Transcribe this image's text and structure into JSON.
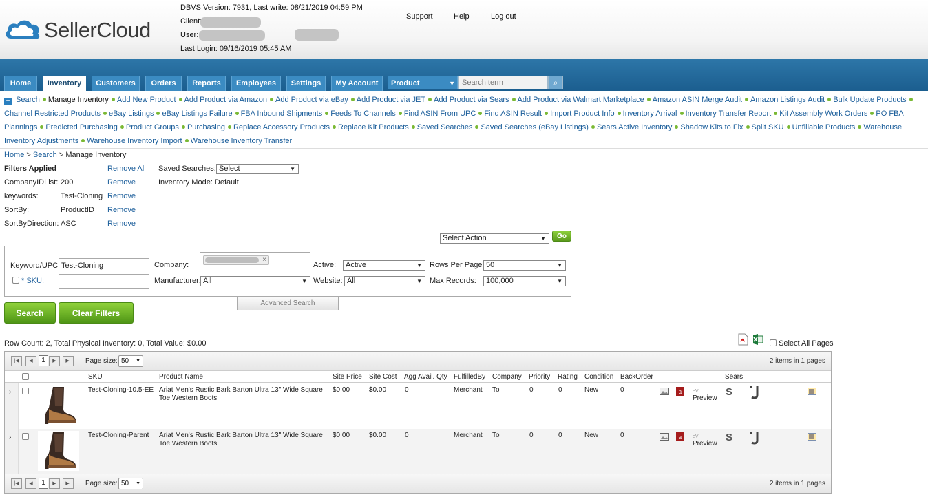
{
  "header": {
    "logo_text": "SellerCloud",
    "dbvs": "DBVS Version: 7931, Last write: 08/21/2019 04:59 PM",
    "client_label": "Client:",
    "user_label": "User:",
    "last_login": "Last Login: 09/16/2019 05:45 AM",
    "links": {
      "support": "Support",
      "help": "Help",
      "logout": "Log out"
    }
  },
  "nav": {
    "tabs": [
      "Home",
      "Inventory",
      "Customers",
      "Orders",
      "Reports",
      "Employees",
      "Settings",
      "My Account"
    ],
    "product_select": "Product",
    "search_placeholder": "Search term"
  },
  "submenu": {
    "search": "Search",
    "current": "Manage Inventory",
    "links": [
      "Add New Product",
      "Add Product via Amazon",
      "Add Product via eBay",
      "Add Product via JET",
      "Add Product via Sears",
      "Add Product via Walmart Marketplace",
      "Amazon ASIN Merge Audit",
      "Amazon Listings Audit",
      "Bulk Update Products",
      "Channel Restricted Products",
      "eBay Listings",
      "eBay Listings Failure",
      "FBA Inbound Shipments",
      "Feeds To Channels",
      "Find ASIN From UPC",
      "Find ASIN Result",
      "Import Product Info",
      "Inventory Arrival",
      "Inventory Transfer Report",
      "Kit Assembly Work Orders",
      "PO FBA Plannings",
      "Predicted Purchasing",
      "Product Groups",
      "Purchasing",
      "Replace Accessory Products",
      "Replace Kit Products",
      "Saved Searches",
      "Saved Searches (eBay Listings)",
      "Sears Active Inventory",
      "Shadow Kits to Fix",
      "Split SKU",
      "Unfillable Products",
      "Warehouse Inventory Adjustments",
      "Warehouse Inventory Import",
      "Warehouse Inventory Transfer"
    ]
  },
  "breadcrumb": {
    "home": "Home",
    "sep": ">",
    "search": "Search",
    "current": "Manage Inventory"
  },
  "filters": {
    "title": "Filters Applied",
    "remove_all": "Remove All",
    "remove": "Remove",
    "items": [
      {
        "label": "CompanyIDList:",
        "value": "200"
      },
      {
        "label": "keywords:",
        "value": "Test-Cloning"
      },
      {
        "label": "SortBy:",
        "value": "ProductID"
      },
      {
        "label": "SortByDirection:",
        "value": "ASC"
      }
    ],
    "saved_searches_label": "Saved Searches:",
    "saved_searches_value": "Select",
    "inventory_mode": "Inventory Mode: Default",
    "select_action": "Select Action",
    "go": "Go"
  },
  "search_form": {
    "keyword_label": "Keyword/UPC:",
    "keyword_value": "Test-Cloning",
    "sku_label": "* SKU:",
    "company_label": "Company:",
    "manufacturer_label": "Manufacturer:",
    "manufacturer_value": "All",
    "active_label": "Active:",
    "active_value": "Active",
    "website_label": "Website:",
    "website_value": "All",
    "rows_label": "Rows Per Page:",
    "rows_value": "50",
    "max_label": "Max Records:",
    "max_value": "100,000",
    "advanced": "Advanced Search",
    "search_btn": "Search",
    "clear_btn": "Clear Filters"
  },
  "summary": "Row Count: 2, Total Physical Inventory: 0, Total Value: $0.00",
  "select_all_pages": "Select All Pages",
  "grid": {
    "page_num": "1",
    "page_size_label": "Page size:",
    "page_size": "50",
    "items_info": "2 items in 1 pages",
    "columns": [
      "SKU",
      "Product Name",
      "Site Price",
      "Site Cost",
      "Agg Avail. Qty",
      "FulfilledBy",
      "Company",
      "Priority",
      "Rating",
      "Condition",
      "BackOrder",
      "Sears"
    ],
    "preview": "Preview",
    "rows": [
      {
        "sku": "Test-Cloning-10.5-EE",
        "name1": "Ariat Men's Rustic Bark Barton Ultra 13\" Wide Square",
        "name2": "Toe Western Boots",
        "price": "$0.00",
        "cost": "$0.00",
        "qty": "0",
        "fulfilled": "Merchant",
        "company": "To",
        "priority": "0",
        "rating": "0",
        "condition": "New",
        "backorder": "0"
      },
      {
        "sku": "Test-Cloning-Parent",
        "name1": "Ariat Men's Rustic Bark Barton Ultra 13\" Wide Square",
        "name2": "Toe Western Boots",
        "price": "$0.00",
        "cost": "$0.00",
        "qty": "0",
        "fulfilled": "Merchant",
        "company": "To",
        "priority": "0",
        "rating": "0",
        "condition": "New",
        "backorder": "0"
      }
    ]
  },
  "colors": {
    "nav": "#1b5e8f",
    "tab": "#3b8bc2",
    "link": "#1a5d9a",
    "green": "#6bb12a",
    "bullet": "#7ab934"
  }
}
